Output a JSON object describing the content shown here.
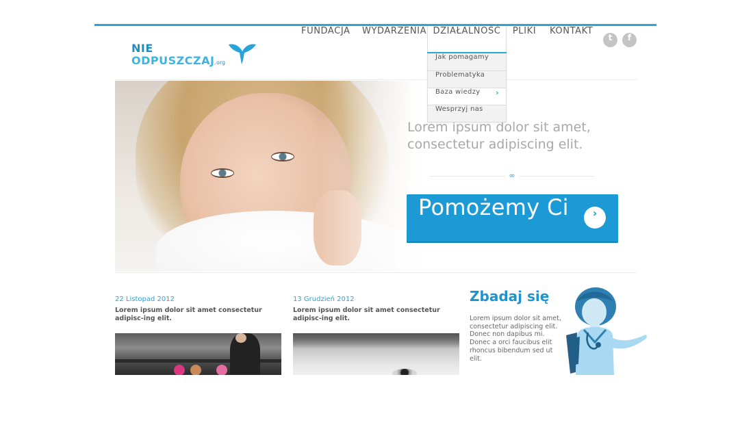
{
  "logo": {
    "line1": "NIE",
    "line2": "ODPUSZCZAJ",
    "tld": ".org"
  },
  "nav": {
    "items": [
      {
        "label": "FUNDACJA"
      },
      {
        "label": "WYDARZENIA"
      },
      {
        "label": "DZIAŁALNOŚĆ"
      },
      {
        "label": "PLIKI"
      },
      {
        "label": "KONTAKT"
      }
    ],
    "active": "DZIAŁALNOŚĆ",
    "social": [
      "twitter-icon",
      "facebook-icon"
    ]
  },
  "dropdown": {
    "items": [
      {
        "label": "Jak pomagamy"
      },
      {
        "label": "Problematyka"
      },
      {
        "label": "Baza wiedzy"
      },
      {
        "label": "Wesprzyj nas"
      }
    ]
  },
  "hero": {
    "line1": "Lorem ipsum dolor sit amet,",
    "line2": "consectetur adipiscing elit.",
    "cta_label": "Pomożemy Ci"
  },
  "news": [
    {
      "date": "22 Listopad 2012",
      "title": "Lorem ipsum dolor sit amet consectetur adipisc-ing elit."
    },
    {
      "date": "13 Grudzień 2012",
      "title": "Lorem ipsum dolor sit amet consectetur adipisc-ing elit."
    }
  ],
  "zbadaj": {
    "title": "Zbadaj się",
    "text": "Lorem ipsum dolor sit amet, consectetur adipiscing elit. Donec non dapibus mi. Donec a orci faucibus elit rhoncus bibendum sed ut elit."
  },
  "colors": {
    "accent": "#29a3d8",
    "cta": "#1b9ad6",
    "text": "#555555",
    "hero_text": "#a8a8a8"
  }
}
